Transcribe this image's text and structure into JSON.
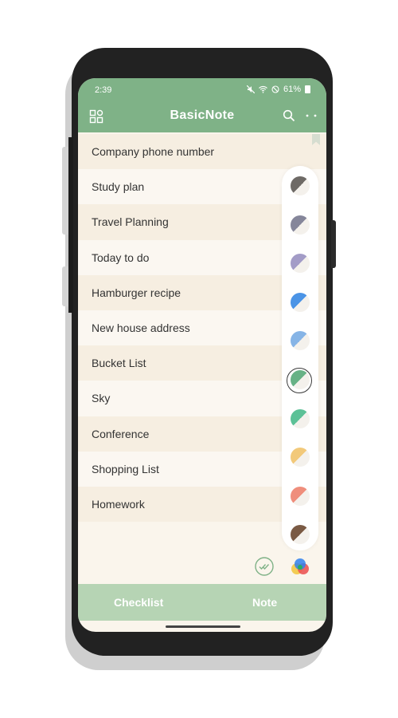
{
  "status_bar": {
    "time": "2:39",
    "battery": "61%"
  },
  "app_bar": {
    "title": "BasicNote",
    "icons": [
      "category-icon",
      "search-icon",
      "more-icon"
    ]
  },
  "notes": [
    "Company phone number",
    "Study plan",
    "Travel Planning",
    "Today to do",
    "Hamburger recipe",
    "New house address",
    "Bucket List",
    "Sky",
    "Conference",
    "Shopping List",
    "Homework"
  ],
  "palette": {
    "swatches": [
      "#6e6a66",
      "#85869a",
      "#a39cc7",
      "#4b94e6",
      "#86b4e6",
      "#67b286",
      "#5cc197",
      "#f2c97a",
      "#ef8e7c",
      "#7a5a44"
    ],
    "selected_index": 5
  },
  "bottom_bar": {
    "checklist": "Checklist",
    "note": "Note"
  },
  "colors": {
    "accent": "#7fb287",
    "tab_bar": "#b6d4b4",
    "background": "#faf5ec"
  }
}
